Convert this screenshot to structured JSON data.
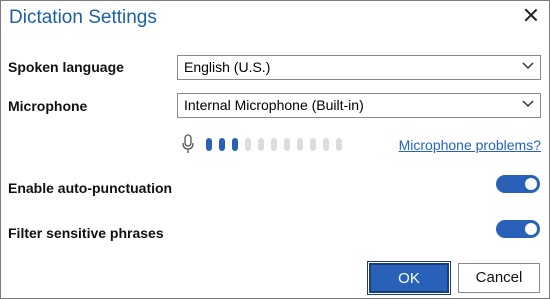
{
  "dialog": {
    "title": "Dictation Settings",
    "close_icon": "close-icon"
  },
  "spoken_language": {
    "label": "Spoken language",
    "value": "English (U.S.)"
  },
  "microphone": {
    "label": "Microphone",
    "value": "Internal Microphone (Built-in)",
    "level_active_bars": 3,
    "level_total_bars": 11,
    "problems_link": "Microphone problems?"
  },
  "auto_punctuation": {
    "label": "Enable auto-punctuation",
    "enabled": true
  },
  "filter_sensitive": {
    "label": "Filter sensitive phrases",
    "enabled": true
  },
  "buttons": {
    "ok": "OK",
    "cancel": "Cancel"
  },
  "colors": {
    "accent": "#2a61b8",
    "title": "#1b5fa8",
    "link": "#2462c4",
    "inactive_bar": "#dcdcdc"
  }
}
